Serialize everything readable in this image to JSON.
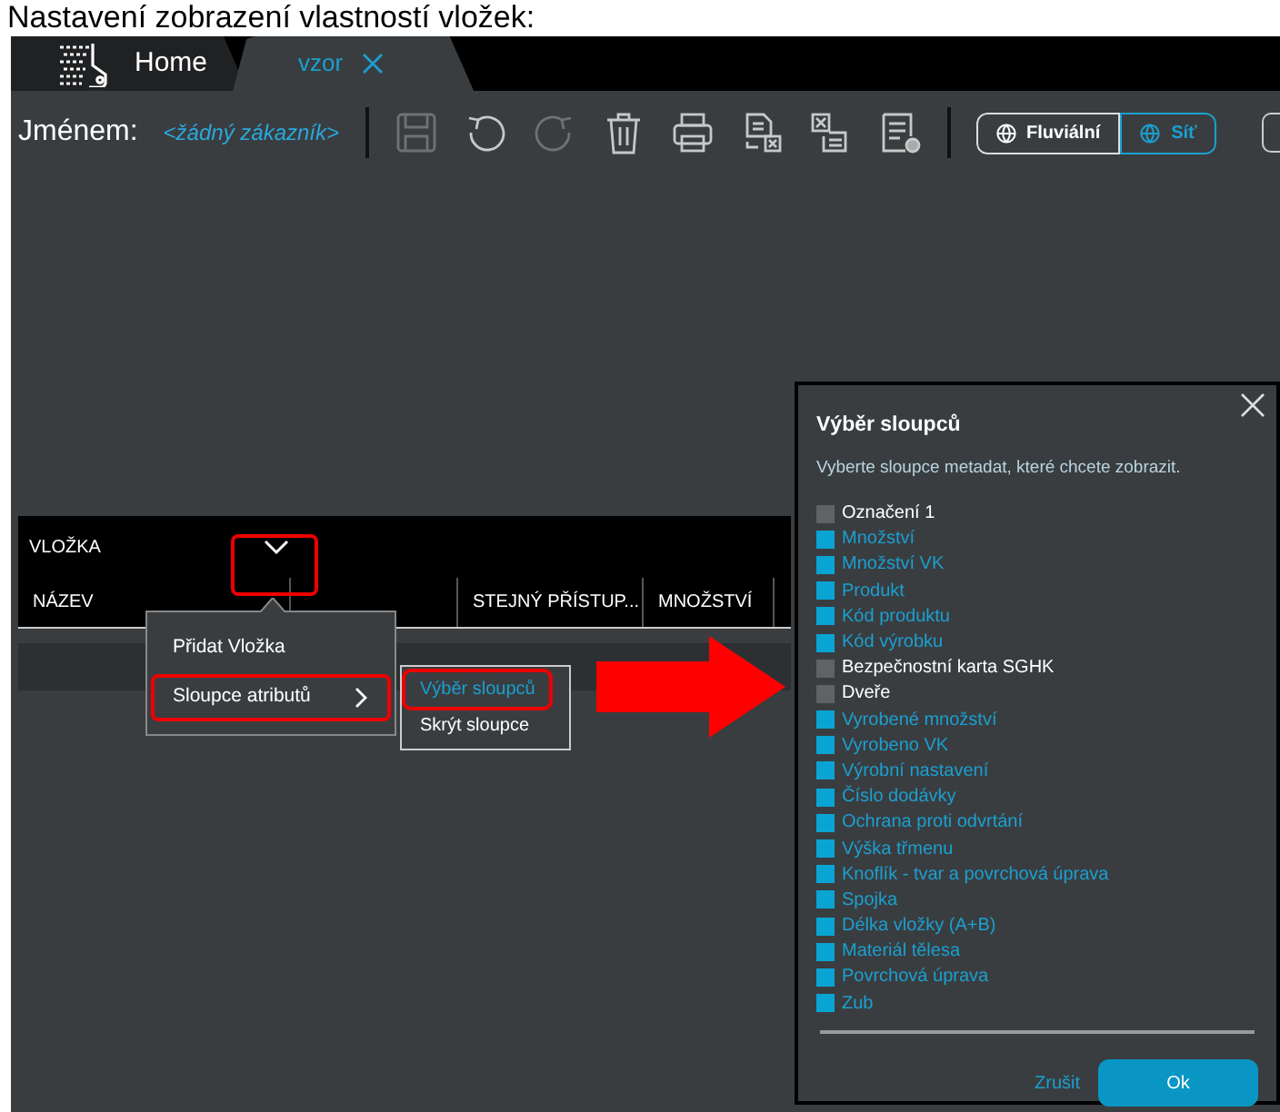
{
  "caption": "Nastavení zobrazení vlastností vložek:",
  "tabs": [
    {
      "label": "Home",
      "selected": false,
      "kind": "home"
    },
    {
      "label": "vzor",
      "selected": true,
      "kind": "document"
    }
  ],
  "toolbar": {
    "customer_label": "Jménem:",
    "customer_value": "<žádný zákazník>",
    "tools": [
      {
        "kind": "save",
        "disabled": true
      },
      {
        "kind": "undo",
        "disabled": false
      },
      {
        "kind": "redo",
        "disabled": true
      },
      {
        "kind": "delete",
        "disabled": false
      },
      {
        "kind": "print",
        "disabled": false
      },
      {
        "kind": "export",
        "disabled": false
      },
      {
        "kind": "import",
        "disabled": false
      },
      {
        "kind": "report",
        "disabled": false
      }
    ],
    "modes": [
      {
        "label": "Fluviální",
        "selected": true
      },
      {
        "label": "Síť",
        "selected": false
      }
    ]
  },
  "table": {
    "title": "VLOŽKA",
    "columns": [
      "NÁZEV",
      "",
      "STEJNÝ PŘÍSTUP...",
      "MNOŽSTVÍ"
    ]
  },
  "context_menu": {
    "items": [
      {
        "label": "Přidat Vložka",
        "has_submenu": false,
        "highlighted": false
      },
      {
        "label": "Sloupce atributů",
        "has_submenu": true,
        "highlighted": true
      }
    ]
  },
  "submenu": {
    "items": [
      {
        "label": "Výběr sloupců",
        "selected": true
      },
      {
        "label": "Skrýt sloupce",
        "selected": false
      }
    ]
  },
  "dialog": {
    "title": "Výběr sloupců",
    "description": "Vyberte sloupce metadat, které chcete zobrazit.",
    "options": [
      {
        "label": "Označení 1",
        "checked": false
      },
      {
        "label": "Množství",
        "checked": true
      },
      {
        "label": "Množství VK",
        "checked": true
      },
      {
        "label": "Produkt",
        "checked": true
      },
      {
        "label": "Kód produktu",
        "checked": true
      },
      {
        "label": "Kód výrobku",
        "checked": true
      },
      {
        "label": "Bezpečnostní karta SGHK",
        "checked": false
      },
      {
        "label": "Dveře",
        "checked": false
      },
      {
        "label": "Vyrobené množství",
        "checked": true
      },
      {
        "label": "Vyrobeno VK",
        "checked": true
      },
      {
        "label": "Výrobní nastavení",
        "checked": true
      },
      {
        "label": "Číslo dodávky",
        "checked": true
      },
      {
        "label": "Ochrana proti odvrtání",
        "checked": true
      },
      {
        "label": "Výška třmenu",
        "checked": true
      },
      {
        "label": "Knoflík - tvar a povrchová úprava",
        "checked": true
      },
      {
        "label": "Spojka",
        "checked": true
      },
      {
        "label": "Délka vložky (A+B)",
        "checked": true
      },
      {
        "label": "Materiál tělesa",
        "checked": true
      },
      {
        "label": "Povrchová úprava",
        "checked": true
      },
      {
        "label": "Zub",
        "checked": true
      }
    ],
    "buttons": [
      {
        "label": "Zrušit",
        "kind": "link"
      },
      {
        "label": "Ok",
        "kind": "primary"
      }
    ]
  }
}
